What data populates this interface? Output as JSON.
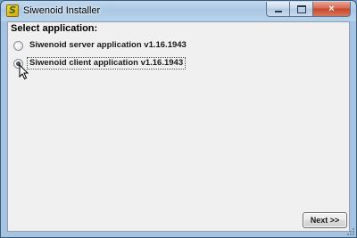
{
  "window": {
    "title": "Siwenoid Installer",
    "icon": "siwenoid-app-icon",
    "controls": {
      "minimize_icon": "minimize-icon",
      "maximize_icon": "maximize-icon",
      "close_label": "×"
    }
  },
  "main": {
    "heading": "Select application:",
    "options": [
      {
        "label": "Siwenoid server application v1.16.1943",
        "selected": false
      },
      {
        "label": "Siwenoid client application v1.16.1943",
        "selected": true
      }
    ],
    "next_label": "Next >>"
  },
  "colors": {
    "titlebar": "#a9c7e5",
    "client_bg": "#f0f0f0",
    "close_button": "#c8452a"
  }
}
